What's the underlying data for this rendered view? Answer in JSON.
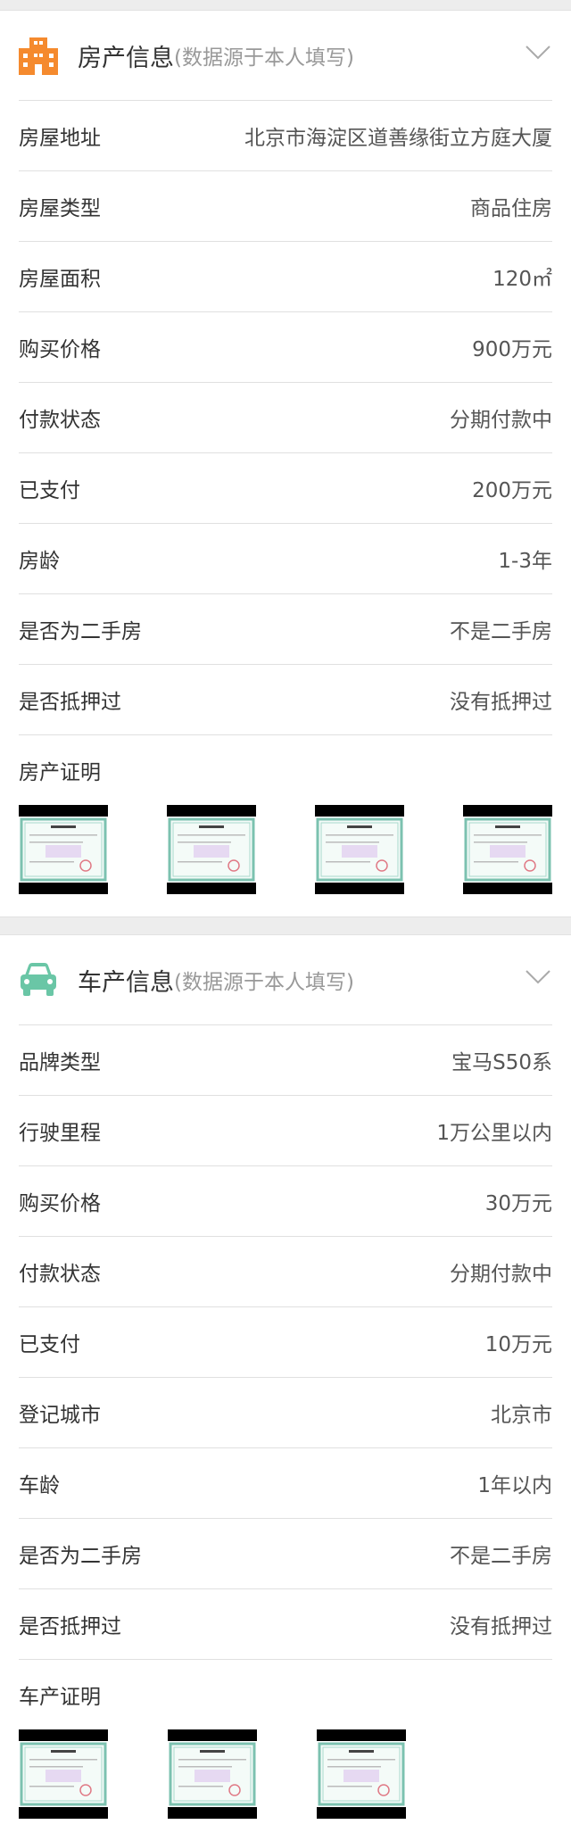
{
  "house": {
    "title": "房产信息",
    "note": "(数据源于本人填写)",
    "icon": "building-icon",
    "icon_color": "#f58a2e",
    "rows": [
      {
        "label": "房屋地址",
        "value": "北京市海淀区道善缘街立方庭大厦"
      },
      {
        "label": "房屋类型",
        "value": "商品住房"
      },
      {
        "label": "房屋面积",
        "value": "120㎡"
      },
      {
        "label": "购买价格",
        "value": "900万元"
      },
      {
        "label": "付款状态",
        "value": "分期付款中"
      },
      {
        "label": "已支付",
        "value": "200万元"
      },
      {
        "label": "房龄",
        "value": "1-3年"
      },
      {
        "label": "是否为二手房",
        "value": "不是二手房"
      },
      {
        "label": "是否抵押过",
        "value": "没有抵押过"
      }
    ],
    "proof_label": "房产证明",
    "proof_count": 4
  },
  "car": {
    "title": "车产信息",
    "note": "(数据源于本人填写)",
    "icon": "car-icon",
    "icon_color": "#6ac6a6",
    "rows": [
      {
        "label": "品牌类型",
        "value": "宝马S50系"
      },
      {
        "label": "行驶里程",
        "value": "1万公里以内"
      },
      {
        "label": "购买价格",
        "value": "30万元"
      },
      {
        "label": "付款状态",
        "value": "分期付款中"
      },
      {
        "label": "已支付",
        "value": "10万元"
      },
      {
        "label": "登记城市",
        "value": "北京市"
      },
      {
        "label": "车龄",
        "value": "1年以内"
      },
      {
        "label": "是否为二手房",
        "value": "不是二手房"
      },
      {
        "label": "是否抵押过",
        "value": "没有抵押过"
      }
    ],
    "proof_label": "车产证明",
    "proof_count": 3
  }
}
